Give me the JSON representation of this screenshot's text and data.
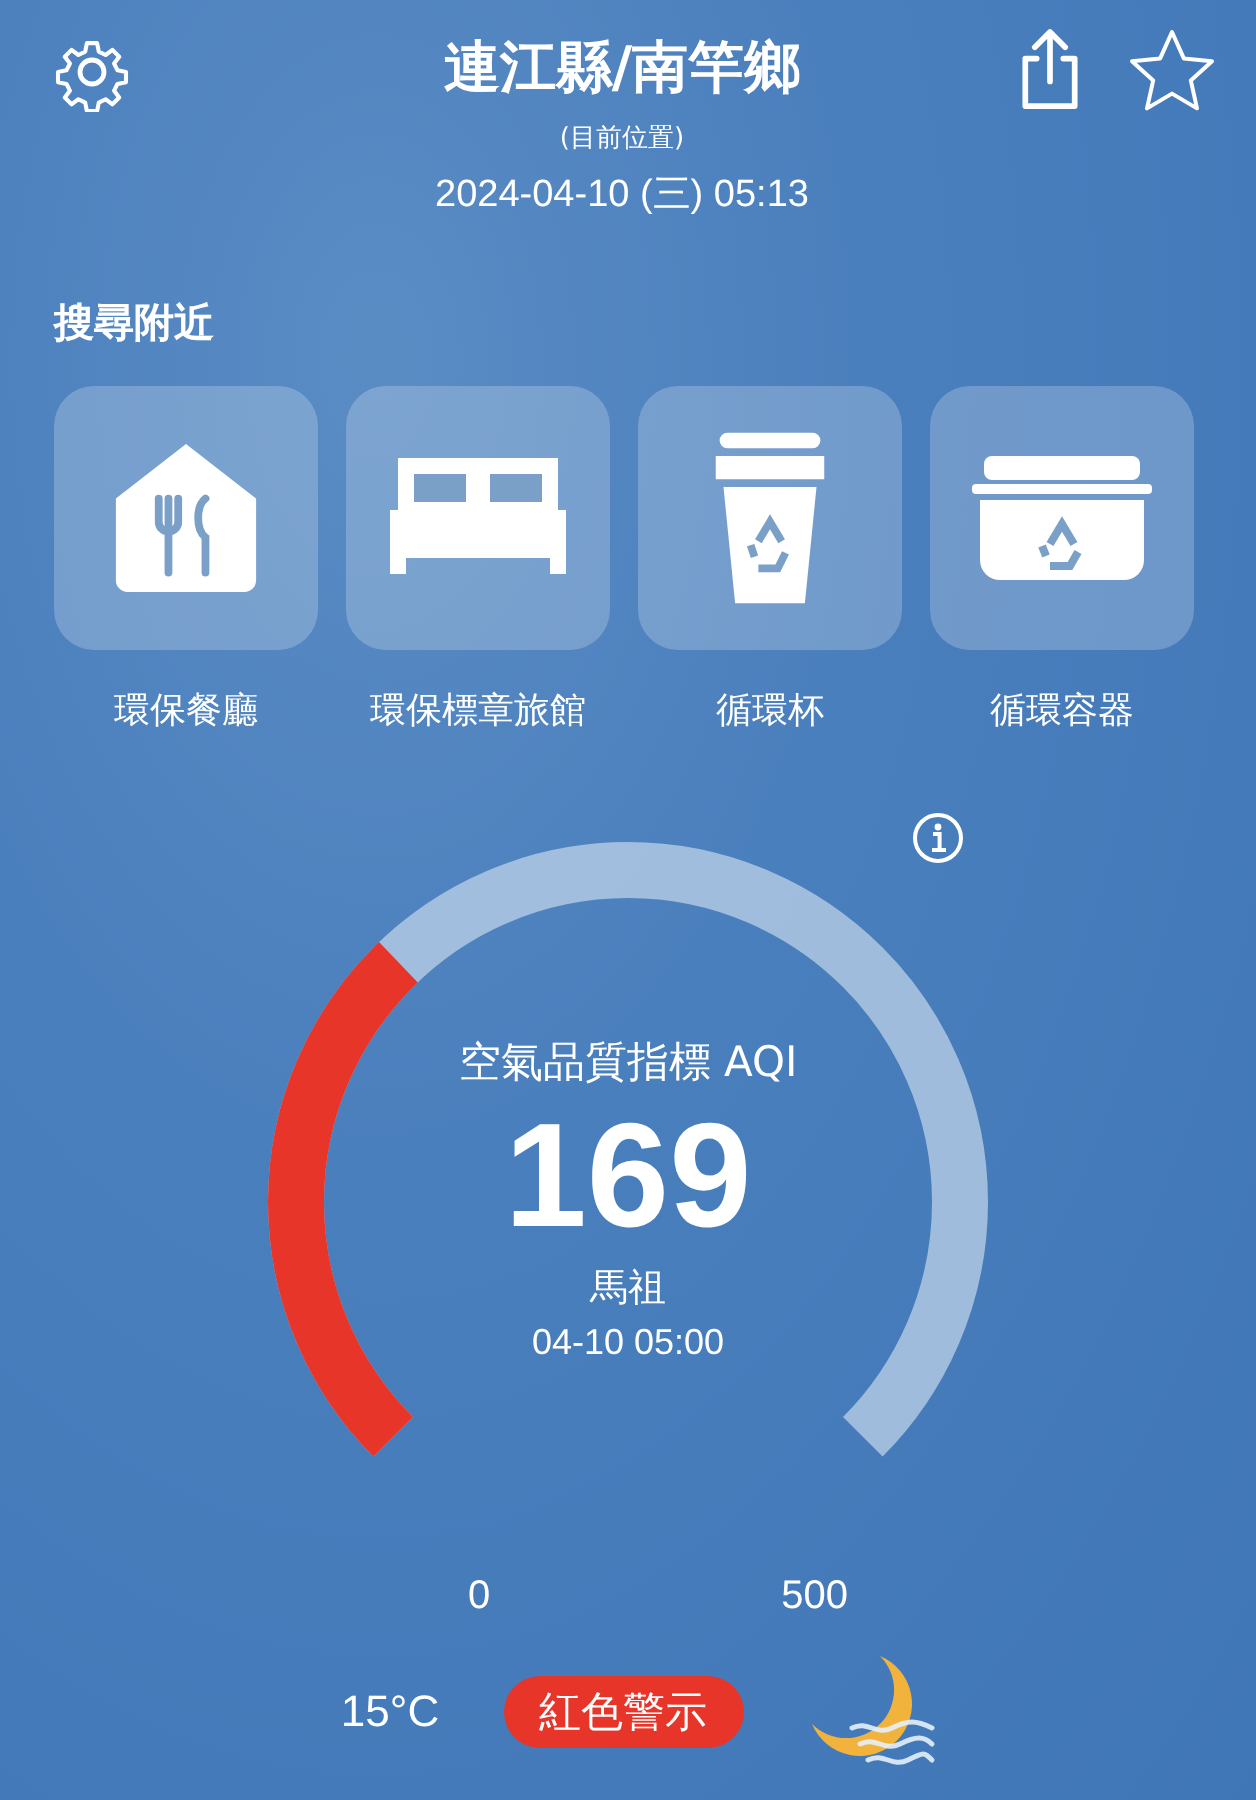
{
  "header": {
    "title": "連江縣/南竿鄉",
    "subtitle": "(目前位置)",
    "datetime": "2024-04-10 (三) 05:13"
  },
  "nearby": {
    "heading": "搜尋附近",
    "items": [
      {
        "label": "環保餐廳",
        "kind": "restaurant"
      },
      {
        "label": "環保標章旅館",
        "kind": "hotel"
      },
      {
        "label": "循環杯",
        "kind": "cup"
      },
      {
        "label": "循環容器",
        "kind": "container"
      }
    ]
  },
  "aqi": {
    "title": "空氣品質指標 AQI",
    "value": "169",
    "station": "馬祖",
    "time": "04-10 05:00",
    "min": "0",
    "max": "500"
  },
  "weather": {
    "temperature": "15°C",
    "alert": "紅色警示"
  }
}
